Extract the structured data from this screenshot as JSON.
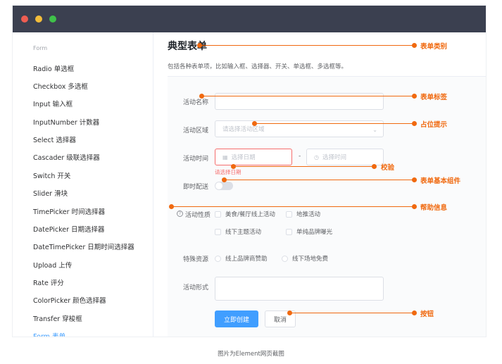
{
  "sidebar": {
    "group_label": "Form",
    "items": [
      {
        "label": "Radio 单选框"
      },
      {
        "label": "Checkbox 多选框"
      },
      {
        "label": "Input 输入框"
      },
      {
        "label": "InputNumber 计数器"
      },
      {
        "label": "Select 选择器"
      },
      {
        "label": "Cascader 级联选择器"
      },
      {
        "label": "Switch 开关"
      },
      {
        "label": "Slider 滑块"
      },
      {
        "label": "TimePicker 时间选择器"
      },
      {
        "label": "DatePicker 日期选择器"
      },
      {
        "label": "DateTimePicker 日期时间选择器"
      },
      {
        "label": "Upload 上传"
      },
      {
        "label": "Rate 评分"
      },
      {
        "label": "ColorPicker 颜色选择器"
      },
      {
        "label": "Transfer 穿梭框"
      },
      {
        "label": "Form 表单",
        "active": true
      }
    ]
  },
  "main": {
    "title": "典型表单",
    "description": "包括各种表单项，比如输入框、选择器、开关、单选框、多选框等。"
  },
  "form": {
    "name_label": "活动名称",
    "name_value": "",
    "region_label": "活动区域",
    "region_placeholder": "请选择活动区域",
    "time_label": "活动时间",
    "date_placeholder": "选择日期",
    "time_placeholder": "选择时间",
    "range_separator": "-",
    "date_error": "请选择日期",
    "delivery_label": "即时配送",
    "delivery_on": false,
    "nature_label": "活动性质",
    "nature_options": [
      "美食/餐厅线上活动",
      "地推活动",
      "线下主题活动",
      "单纯品牌曝光"
    ],
    "resource_label": "特殊资源",
    "resource_options": [
      "线上品牌商赞助",
      "线下场地免费"
    ],
    "form_label": "活动形式",
    "submit_label": "立即创建",
    "cancel_label": "取消"
  },
  "annotations": {
    "form_category": "表单类别",
    "form_label": "表单标签",
    "placeholder": "占位提示",
    "validation": "校验",
    "basic_component": "表单基本组件",
    "help": "帮助信息",
    "button": "按钮"
  },
  "caption": "图片为Element网页截图",
  "colors": {
    "accent": "#409eff",
    "annotation": "#f0690f",
    "error": "#f56c6c",
    "titlebar": "#3b4050"
  }
}
